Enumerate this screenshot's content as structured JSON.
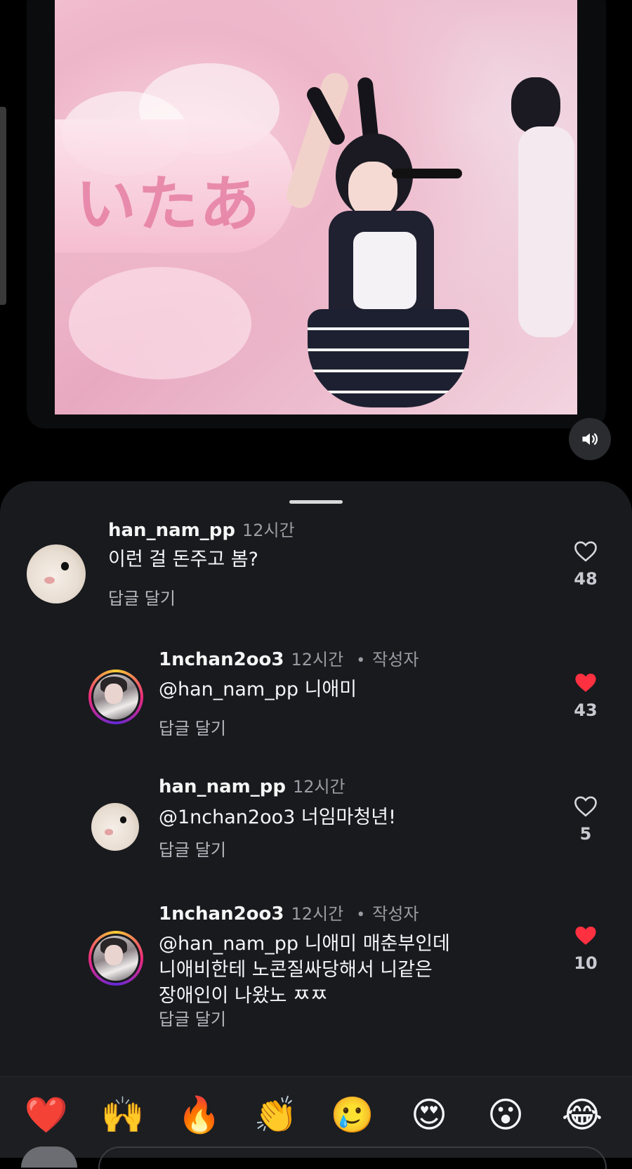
{
  "video": {
    "sound_icon": "speaker-volume-icon"
  },
  "comments": [
    {
      "username": "han_nam_pp",
      "time": "12시간",
      "text": "이런 걸 돈주고 봄?",
      "reply_label": "답글 달기",
      "likes": "48",
      "liked": false
    },
    {
      "username": "1nchan2oo3",
      "time": "12시간",
      "author_badge": "작성자",
      "text": "@han_nam_pp 니애미",
      "reply_label": "답글 달기",
      "likes": "43",
      "liked": true
    },
    {
      "username": "han_nam_pp",
      "time": "12시간",
      "text": "@1nchan2oo3 너임마청년!",
      "reply_label": "답글 달기",
      "likes": "5",
      "liked": false
    },
    {
      "username": "1nchan2oo3",
      "time": "12시간",
      "author_badge": "작성자",
      "text": "@han_nam_pp 니애미 매춘부인데\n니애비한테 노콘질싸당해서 니같은\n장애인이 나왔노 ㅉㅉ",
      "reply_label": "답글 달기",
      "likes": "10",
      "liked": true
    }
  ],
  "emoji_bar": [
    "❤️",
    "🙌",
    "🔥",
    "👏",
    "🥲",
    "😍",
    "😮",
    "😂"
  ],
  "colors": {
    "sheet_bg": "#181a1e",
    "like_red": "#ff3040",
    "muted_text": "#9a9ca3"
  }
}
